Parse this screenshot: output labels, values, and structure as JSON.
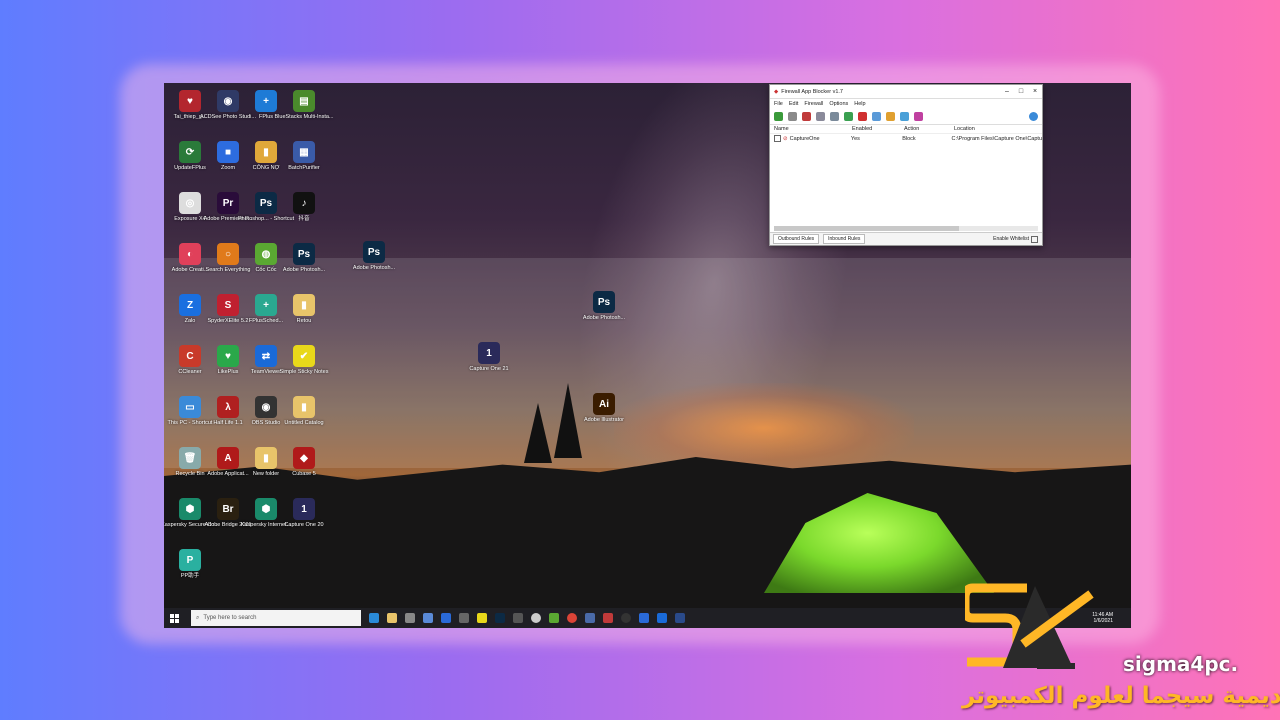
{
  "desktop_icons": [
    {
      "label": "Tai_thiep_g...",
      "color": "#b3262e",
      "glyph": "♥"
    },
    {
      "label": "ACDSee Photo Studi...",
      "color": "#2f3a66",
      "glyph": "◉"
    },
    {
      "label": "FPlus",
      "color": "#1e7bd6",
      "glyph": "+"
    },
    {
      "label": "BlueStacks Multi-Insta...",
      "color": "#4a8a2c",
      "glyph": "▤"
    },
    {
      "label": "UpdateFPlus",
      "color": "#2a7a3a",
      "glyph": "⟳"
    },
    {
      "label": "Zoom",
      "color": "#2d6cdf",
      "glyph": "■"
    },
    {
      "label": "CÔNG NỢ",
      "color": "#e0a83a",
      "glyph": "▮"
    },
    {
      "label": "BatchPurifier",
      "color": "#3a5ba8",
      "glyph": "▦"
    },
    {
      "label": "Exposure X4",
      "color": "#ddd",
      "glyph": "◎"
    },
    {
      "label": "Adobe Premiere P...",
      "color": "#2a0c3a",
      "glyph": "Pr"
    },
    {
      "label": "Photoshop... - Shortcut",
      "color": "#0c2a45",
      "glyph": "Ps"
    },
    {
      "label": "抖音",
      "color": "#111",
      "glyph": "♪"
    },
    {
      "label": "Adobe Creati...",
      "color": "#e0405a",
      "glyph": "◐"
    },
    {
      "label": "Search Everything",
      "color": "#e07a1a",
      "glyph": "○"
    },
    {
      "label": "Cốc Cốc",
      "color": "#5aa832",
      "glyph": "◍"
    },
    {
      "label": "Adobe Photosh...",
      "color": "#0c2a45",
      "glyph": "Ps"
    },
    {
      "label": "Zalo",
      "color": "#1a6fe0",
      "glyph": "Z"
    },
    {
      "label": "SpyderXElite 5.2",
      "color": "#c02030",
      "glyph": "S"
    },
    {
      "label": "FPlusSched...",
      "color": "#2aa890",
      "glyph": "+"
    },
    {
      "label": "Retou",
      "color": "#e8c46a",
      "glyph": "▮"
    },
    {
      "label": "CCleaner",
      "color": "#c83a2a",
      "glyph": "C"
    },
    {
      "label": "LikePlus",
      "color": "#2aa84a",
      "glyph": "♥"
    },
    {
      "label": "TeamViewer",
      "color": "#1a6ad8",
      "glyph": "⇄"
    },
    {
      "label": "Simple Sticky Notes",
      "color": "#e8d81a",
      "glyph": "✔"
    },
    {
      "label": "This PC - Shortcut",
      "color": "#3a8ad8",
      "glyph": "▭"
    },
    {
      "label": "Half Life 1.1",
      "color": "#b02020",
      "glyph": "λ"
    },
    {
      "label": "OBS Studio",
      "color": "#333",
      "glyph": "◉"
    },
    {
      "label": "Untitled Catalog",
      "color": "#e8c46a",
      "glyph": "▮"
    },
    {
      "label": "Recycle Bin",
      "color": "#8aa",
      "glyph": "🗑"
    },
    {
      "label": "Adobe Applicat...",
      "color": "#b01a1a",
      "glyph": "A"
    },
    {
      "label": "New folder",
      "color": "#e8c46a",
      "glyph": "▮"
    },
    {
      "label": "Cubase 5",
      "color": "#b01a1a",
      "glyph": "◆"
    },
    {
      "label": "Kaspersky Secure Co...",
      "color": "#1a8a6a",
      "glyph": "⬢"
    },
    {
      "label": "Adobe Bridge 2021",
      "color": "#2a2010",
      "glyph": "Br"
    },
    {
      "label": "Kaspersky Internet...",
      "color": "#1a8a6a",
      "glyph": "⬢"
    },
    {
      "label": "Capture One 20",
      "color": "#2a2a5a",
      "glyph": "1"
    },
    {
      "label": "PP助手",
      "color": "#2ab0a0",
      "glyph": "P"
    }
  ],
  "free_icons": [
    {
      "label": "Adobe Photosh...",
      "color": "#0c2a45",
      "glyph": "Ps"
    },
    {
      "label": "Adobe Photosh...",
      "color": "#0c2a45",
      "glyph": "Ps"
    },
    {
      "label": "Capture One 21",
      "color": "#2a2a5a",
      "glyph": "1"
    },
    {
      "label": "Adobe Illustrator",
      "color": "#3a1c00",
      "glyph": "Ai"
    }
  ],
  "firewall": {
    "title": "Firewall App Blocker v1.7",
    "menu": [
      "File",
      "Edit",
      "Firewall",
      "Options",
      "Help"
    ],
    "columns": [
      "Name",
      "Enabled",
      "Action",
      "Location"
    ],
    "rows": [
      {
        "name": "CaptureOne",
        "enabled": "Yes",
        "action": "Block",
        "location": "C:\\Program Files\\Capture One\\Captu"
      }
    ],
    "tabs": [
      "Outbound Rules",
      "Inbound Rules"
    ],
    "whitelist_label": "Enable Whitelist"
  },
  "taskbar": {
    "search_placeholder": "Type here to search",
    "time": "11:46 AM",
    "date": "1/6/2021"
  },
  "branding": {
    "site": "sigma4pc.",
    "arabic": "اكاديمية سيجما لعلوم الكمبيوتر"
  }
}
